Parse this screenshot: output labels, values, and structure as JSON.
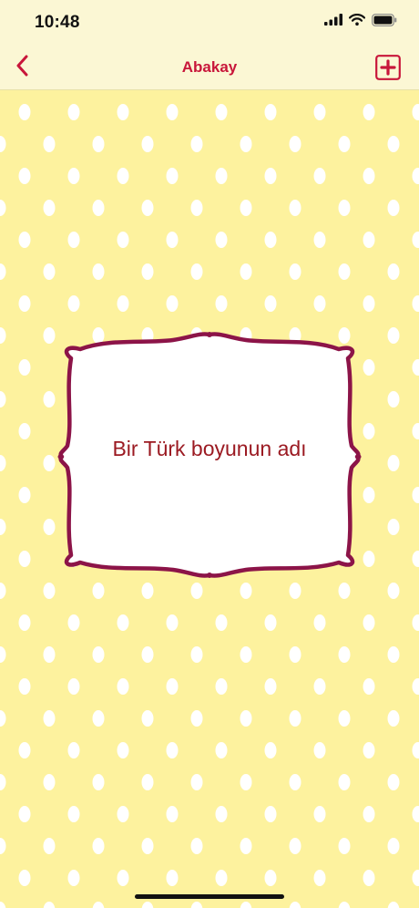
{
  "status_bar": {
    "time": "10:48",
    "icons": [
      "cellular-signal-icon",
      "wifi-icon",
      "battery-icon"
    ]
  },
  "nav": {
    "back_icon": "chevron-left-icon",
    "title": "Abakay",
    "add_icon": "plus-square-icon"
  },
  "card": {
    "text": "Bir Türk boyunun adı"
  },
  "colors": {
    "background": "#fdf29e",
    "dots": "#ffffff",
    "bar": "#fbf7d4",
    "accent": "#c8163a",
    "frame": "#8c1448",
    "card_text": "#9b1a22"
  }
}
